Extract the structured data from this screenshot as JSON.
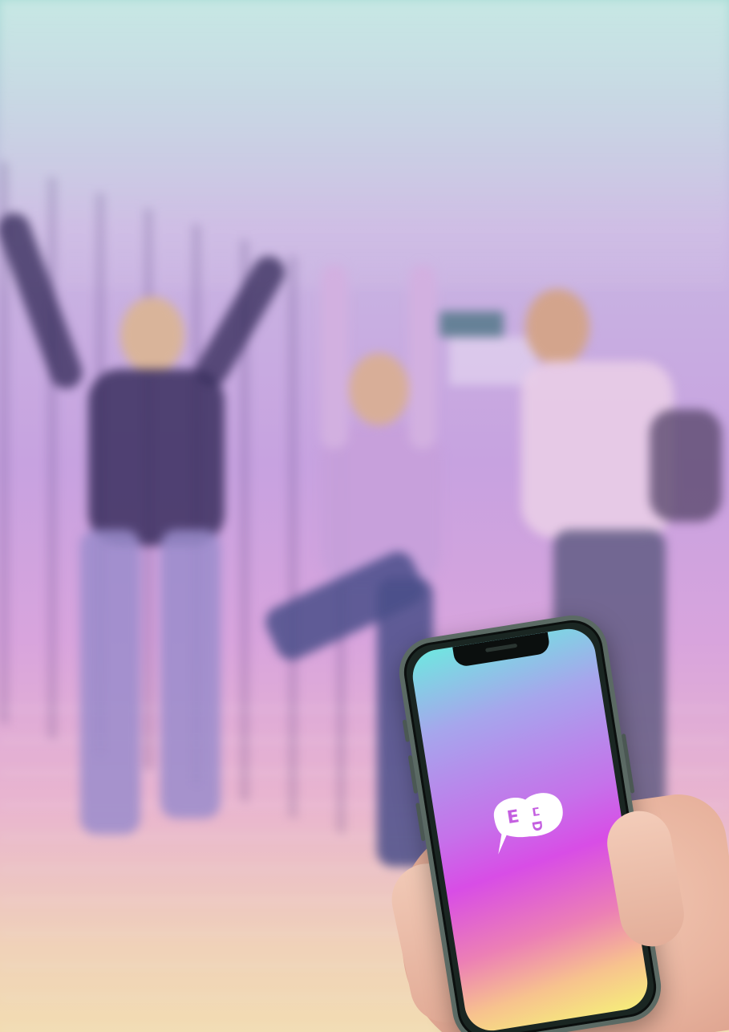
{
  "scene": {
    "description_visible": false
  },
  "phone_app": {
    "logo_icon": "speech-bubble-face-logo-icon",
    "logo_letters": [
      "E",
      "ⵎ",
      "D"
    ]
  },
  "colors": {
    "screen_top": "#6fe7e0",
    "screen_mid": "#d84de6",
    "screen_bottom": "#f6ee7a",
    "logo_fill": "#ffffff",
    "logo_letter": "#c45fe0"
  }
}
